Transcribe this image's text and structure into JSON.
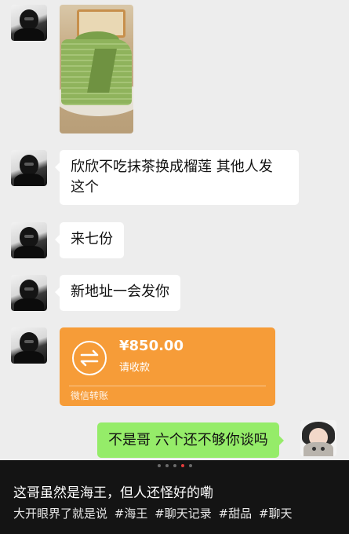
{
  "messages": [
    {
      "from": "other",
      "type": "image",
      "image_desc": "matcha crepe cake photo"
    },
    {
      "from": "other",
      "type": "text",
      "lines": [
        "欣欣不吃抹茶换成榴莲 其他人发",
        "这个"
      ]
    },
    {
      "from": "other",
      "type": "text",
      "text": "来七份"
    },
    {
      "from": "other",
      "type": "text",
      "text": "新地址一会发你"
    },
    {
      "from": "other",
      "type": "transfer",
      "amount": "¥850.00",
      "status": "请收款",
      "footer": "微信转账",
      "icon": "transfer-arrows-icon",
      "color": "#f69c38"
    },
    {
      "from": "me",
      "type": "text",
      "text": "不是哥 六个还不够你谈吗",
      "color": "#95ec69"
    }
  ],
  "caption": {
    "title": "这哥虽然是海王，但人还怪好的嘞",
    "text": "大开眼界了就是说",
    "tags": [
      "#海王",
      "#聊天记录",
      "#甜品",
      "#聊天"
    ]
  },
  "pager": {
    "count": 5,
    "active": 3
  }
}
